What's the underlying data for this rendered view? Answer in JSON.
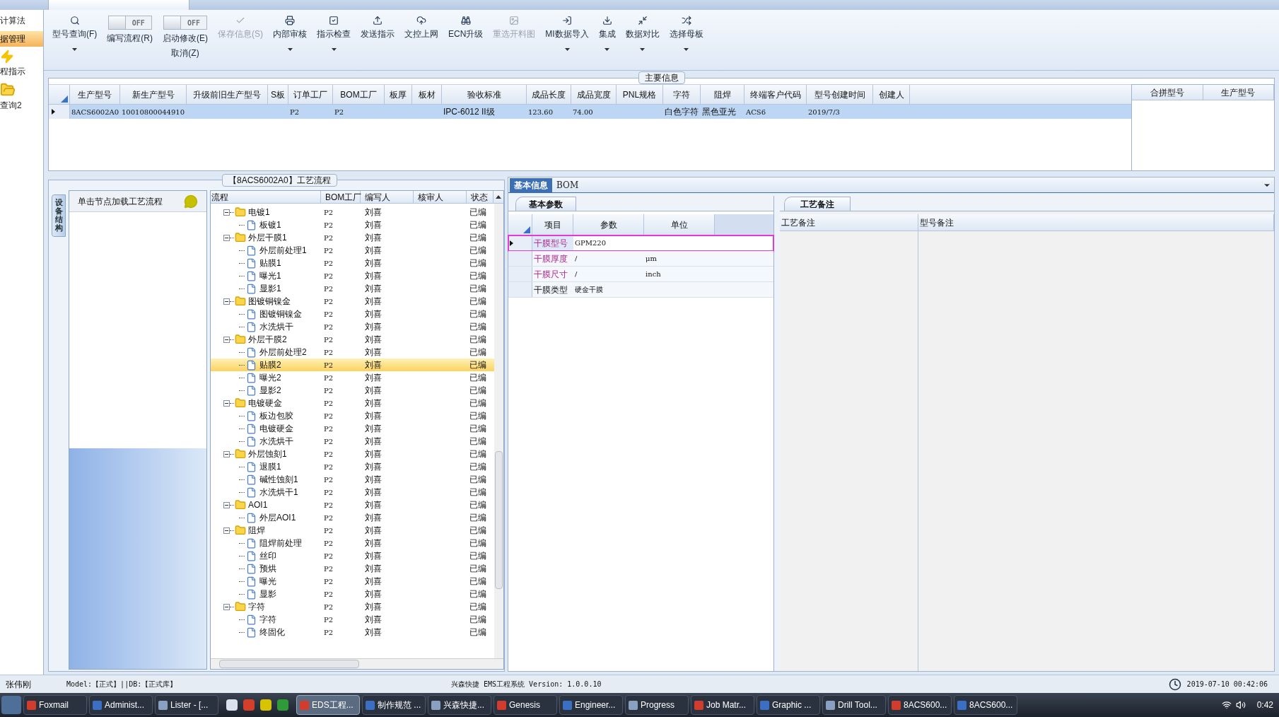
{
  "sidebar": {
    "items": [
      {
        "label": "计算法",
        "selected": false,
        "kind": "text"
      },
      {
        "label": "据管理",
        "selected": true,
        "kind": "text"
      },
      {
        "label": "程指示",
        "selected": false,
        "kind": "bolt_entry"
      },
      {
        "label": "查询2",
        "selected": false,
        "kind": "folder_entry"
      }
    ]
  },
  "toolbar": {
    "buttons": [
      {
        "kind": "icon",
        "label": "型号查询(F)",
        "disabled": false,
        "dropdown": true
      },
      {
        "kind": "switch",
        "label": "编写流程(R)",
        "switch_text": "OFF",
        "on": false,
        "dropdown": false
      },
      {
        "kind": "switch",
        "label": "启动修改(E)",
        "sub_label": "取消(Z)",
        "switch_text": "OFF",
        "on": false,
        "dropdown": false
      },
      {
        "kind": "icon",
        "label": "保存信息(S)",
        "disabled": true,
        "dropdown": false
      },
      {
        "kind": "icon",
        "label": "内部审核",
        "disabled": false,
        "dropdown": true
      },
      {
        "kind": "icon",
        "label": "指示检查",
        "disabled": false,
        "dropdown": true
      },
      {
        "kind": "icon",
        "label": "发送指示",
        "disabled": false,
        "dropdown": false
      },
      {
        "kind": "icon",
        "label": "文控上网",
        "disabled": false,
        "dropdown": false
      },
      {
        "kind": "icon",
        "label": "ECN升级",
        "disabled": false,
        "dropdown": false
      },
      {
        "kind": "icon",
        "label": "重选开料图",
        "disabled": true,
        "dropdown": false
      },
      {
        "kind": "icon",
        "label": "MI数据导入",
        "disabled": false,
        "dropdown": true
      },
      {
        "kind": "icon",
        "label": "集成",
        "disabled": false,
        "dropdown": true
      },
      {
        "kind": "icon",
        "label": "数据对比",
        "disabled": false,
        "dropdown": true
      },
      {
        "kind": "icon",
        "label": "选择母板",
        "disabled": false,
        "dropdown": true
      }
    ]
  },
  "main_info": {
    "title": "主要信息",
    "table": {
      "columns": [
        "生产型号",
        "新生产型号",
        "升级前旧生产型号",
        "S板",
        "订单工厂",
        "BOM工厂",
        "板厚",
        "板材",
        "验收标准",
        "成品长度",
        "成品宽度",
        "PNL规格",
        "字符",
        "阻焊",
        "终端客户代码",
        "型号创建时间",
        "创建人"
      ],
      "rows": [
        {
          "selected": true,
          "cells": [
            "8ACS6002A0",
            "10010800044910",
            null,
            null,
            "P2",
            "P2",
            null,
            null,
            "IPC-6012 II级",
            "123.60",
            "74.00",
            null,
            "白色字符",
            "黑色亚光",
            "ACS6",
            "2019/7/3",
            null
          ]
        }
      ]
    },
    "side_table": {
      "columns": [
        "合拼型号",
        "生产型号"
      ]
    }
  },
  "process": {
    "title": "【8ACS6002A0】工艺流程",
    "vertical_tab": "设备结构",
    "node_hint": "单击节点加载工艺流程",
    "columns": [
      "流程",
      "BOM工厂",
      "编写人",
      "核审人",
      "状态"
    ],
    "tree": [
      {
        "name": "电镀1",
        "factory": "P2",
        "writer": "刘喜",
        "status": "已编",
        "expanded": true,
        "selected": false,
        "children": [
          {
            "name": "板镀1",
            "factory": "P2",
            "writer": "刘喜",
            "status": "已编",
            "selected": false
          }
        ]
      },
      {
        "name": "外层干膜1",
        "factory": "P2",
        "writer": "刘喜",
        "status": "已编",
        "expanded": true,
        "selected": false,
        "children": [
          {
            "name": "外层前处理1",
            "factory": "P2",
            "writer": "刘喜",
            "status": "已编",
            "selected": false
          },
          {
            "name": "贴膜1",
            "factory": "P2",
            "writer": "刘喜",
            "status": "已编",
            "selected": false
          },
          {
            "name": "曝光1",
            "factory": "P2",
            "writer": "刘喜",
            "status": "已编",
            "selected": false
          },
          {
            "name": "显影1",
            "factory": "P2",
            "writer": "刘喜",
            "status": "已编",
            "selected": false
          }
        ]
      },
      {
        "name": "图镀铜镍金",
        "factory": "P2",
        "writer": "刘喜",
        "status": "已编",
        "expanded": true,
        "selected": false,
        "children": [
          {
            "name": "图镀铜镍金",
            "factory": "P2",
            "writer": "刘喜",
            "status": "已编",
            "selected": false
          },
          {
            "name": "水洗烘干",
            "factory": "P2",
            "writer": "刘喜",
            "status": "已编",
            "selected": false
          }
        ]
      },
      {
        "name": "外层干膜2",
        "factory": "P2",
        "writer": "刘喜",
        "status": "已编",
        "expanded": true,
        "selected": false,
        "children": [
          {
            "name": "外层前处理2",
            "factory": "P2",
            "writer": "刘喜",
            "status": "已编",
            "selected": false
          },
          {
            "name": "贴膜2",
            "factory": "P2",
            "writer": "刘喜",
            "status": "已编",
            "selected": true
          },
          {
            "name": "曝光2",
            "factory": "P2",
            "writer": "刘喜",
            "status": "已编",
            "selected": false
          },
          {
            "name": "显影2",
            "factory": "P2",
            "writer": "刘喜",
            "status": "已编",
            "selected": false
          }
        ]
      },
      {
        "name": "电镀硬金",
        "factory": "P2",
        "writer": "刘喜",
        "status": "已编",
        "expanded": true,
        "selected": false,
        "children": [
          {
            "name": "板边包胶",
            "factory": "P2",
            "writer": "刘喜",
            "status": "已编",
            "selected": false
          },
          {
            "name": "电镀硬金",
            "factory": "P2",
            "writer": "刘喜",
            "status": "已编",
            "selected": false
          },
          {
            "name": "水洗烘干",
            "factory": "P2",
            "writer": "刘喜",
            "status": "已编",
            "selected": false
          }
        ]
      },
      {
        "name": "外层蚀刻1",
        "factory": "P2",
        "writer": "刘喜",
        "status": "已编",
        "expanded": true,
        "selected": false,
        "children": [
          {
            "name": "退膜1",
            "factory": "P2",
            "writer": "刘喜",
            "status": "已编",
            "selected": false
          },
          {
            "name": "碱性蚀刻1",
            "factory": "P2",
            "writer": "刘喜",
            "status": "已编",
            "selected": false
          },
          {
            "name": "水洗烘干1",
            "factory": "P2",
            "writer": "刘喜",
            "status": "已编",
            "selected": false
          }
        ]
      },
      {
        "name": "AOI1",
        "factory": "P2",
        "writer": "刘喜",
        "status": "已编",
        "expanded": true,
        "selected": false,
        "children": [
          {
            "name": "外层AOI1",
            "factory": "P2",
            "writer": "刘喜",
            "status": "已编",
            "selected": false
          }
        ]
      },
      {
        "name": "阻焊",
        "factory": "P2",
        "writer": "刘喜",
        "status": "已编",
        "expanded": true,
        "selected": false,
        "children": [
          {
            "name": "阻焊前处理",
            "factory": "P2",
            "writer": "刘喜",
            "status": "已编",
            "selected": false
          },
          {
            "name": "丝印",
            "factory": "P2",
            "writer": "刘喜",
            "status": "已编",
            "selected": false
          },
          {
            "name": "预烘",
            "factory": "P2",
            "writer": "刘喜",
            "status": "已编",
            "selected": false
          },
          {
            "name": "曝光",
            "factory": "P2",
            "writer": "刘喜",
            "status": "已编",
            "selected": false
          },
          {
            "name": "显影",
            "factory": "P2",
            "writer": "刘喜",
            "status": "已编",
            "selected": false
          }
        ]
      },
      {
        "name": "字符",
        "factory": "P2",
        "writer": "刘喜",
        "status": "已编",
        "expanded": true,
        "selected": false,
        "children": [
          {
            "name": "字符",
            "factory": "P2",
            "writer": "刘喜",
            "status": "已编",
            "selected": false
          },
          {
            "name": "终固化",
            "factory": "P2",
            "writer": "刘喜",
            "status": "已编",
            "selected": false
          }
        ]
      }
    ]
  },
  "detail": {
    "tabs": [
      {
        "label": "基本信息",
        "selected": true
      },
      {
        "label": "BOM",
        "selected": false
      }
    ],
    "params_tab": "基本参数",
    "params": {
      "columns": [
        "项目",
        "参数",
        "单位"
      ],
      "rows": [
        {
          "item": "干膜型号",
          "value": "GPM220",
          "required": true,
          "selected": true,
          "highlighted": true
        },
        {
          "item": "干膜厚度",
          "value": "/",
          "unit": "μm",
          "required": true,
          "selected": false,
          "highlighted": false
        },
        {
          "item": "干膜尺寸",
          "value": "/",
          "unit": "inch",
          "required": true,
          "selected": false,
          "highlighted": false
        },
        {
          "item": "干膜类型",
          "value": "硬金干膜",
          "required": false,
          "selected": false,
          "highlighted": false
        }
      ]
    },
    "notes_tab": "工艺备注",
    "notes_columns": [
      "工艺备注",
      "型号备注"
    ]
  },
  "status_bar": {
    "user": "张伟刚",
    "model": "Model:【正式】||DB:【正式库】",
    "system": "兴森快捷 EMS工程系统 Version: 1.0.0.10",
    "datetime": "2019-07-10 00:42:06"
  },
  "taskbar": {
    "items": [
      {
        "label": "Foxmail",
        "selected": false
      },
      {
        "label": "Administ...",
        "selected": false
      },
      {
        "label": "Lister - [...",
        "selected": false
      },
      {
        "label": "EDS工程...",
        "selected": true
      },
      {
        "label": "制作规范 ...",
        "selected": false
      },
      {
        "label": "兴森快捷...",
        "selected": false
      },
      {
        "label": "Genesis",
        "selected": false
      },
      {
        "label": "Engineer...",
        "selected": false
      },
      {
        "label": "Progress",
        "selected": false
      },
      {
        "label": "Job Matr...",
        "selected": false
      },
      {
        "label": "Graphic ...",
        "selected": false
      },
      {
        "label": "Drill Tool...",
        "selected": false
      },
      {
        "label": "8ACS600...",
        "selected": false
      },
      {
        "label": "8ACS600...",
        "selected": false
      }
    ],
    "clock": "0:42"
  }
}
